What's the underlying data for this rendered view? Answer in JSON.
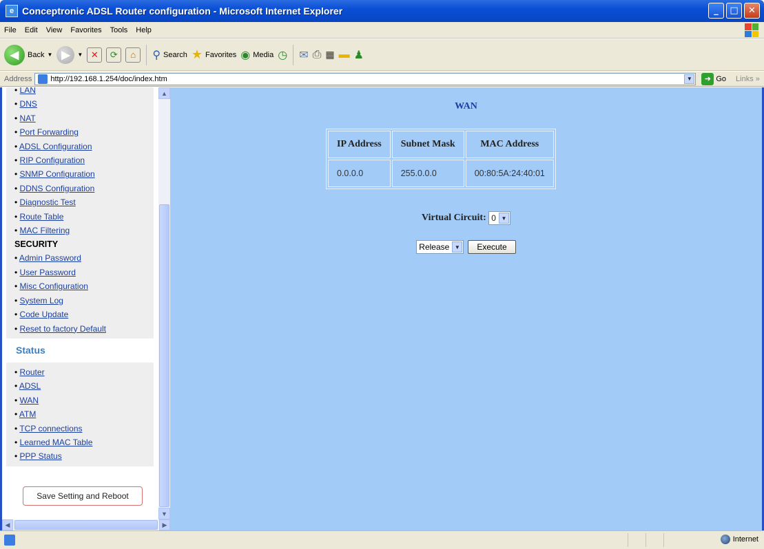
{
  "window": {
    "title": "Conceptronic ADSL Router configuration - Microsoft Internet Explorer",
    "buttons": {
      "minimize": "_",
      "maximize": "□",
      "close": "✕"
    }
  },
  "menubar": [
    "File",
    "Edit",
    "View",
    "Favorites",
    "Tools",
    "Help"
  ],
  "toolbar": {
    "back": "Back",
    "search": "Search",
    "favorites": "Favorites",
    "media": "Media"
  },
  "address": {
    "label": "Address",
    "url": "http://192.168.1.254/doc/index.htm",
    "go": "Go",
    "links": "Links »"
  },
  "sidebar": {
    "config_items": [
      "LAN",
      "DNS",
      "NAT",
      "Port Forwarding",
      "ADSL Configuration",
      "RIP Configuration",
      "SNMP Configuration",
      "DDNS Configuration",
      "Diagnostic Test",
      "Route Table",
      "MAC Filtering"
    ],
    "security_heading": "SECURITY",
    "security_items": [
      "Admin Password",
      "User Password",
      "Misc Configuration",
      "System Log",
      "Code Update",
      "Reset to factory Default"
    ],
    "status_heading": "Status",
    "status_items": [
      "Router",
      "ADSL",
      "WAN",
      "ATM",
      "TCP connections",
      "Learned MAC Table",
      "PPP Status"
    ],
    "save_button": "Save Setting and Reboot"
  },
  "main": {
    "title": "WAN",
    "table": {
      "headers": [
        "IP Address",
        "Subnet Mask",
        "MAC Address"
      ],
      "rows": [
        [
          "0.0.0.0",
          "255.0.0.0",
          "00:80:5A:24:40:01"
        ]
      ]
    },
    "virtual_circuit_label": "Virtual Circuit:",
    "virtual_circuit_value": "0",
    "action_value": "Release",
    "execute_button": "Execute"
  },
  "statusbar": {
    "zone": "Internet"
  },
  "colors": {
    "page_background": "#a2cbf7",
    "heading_blue": "#1a3fa0",
    "status_heading": "#3a7fbf",
    "titlebar": "#0a4fd6"
  }
}
